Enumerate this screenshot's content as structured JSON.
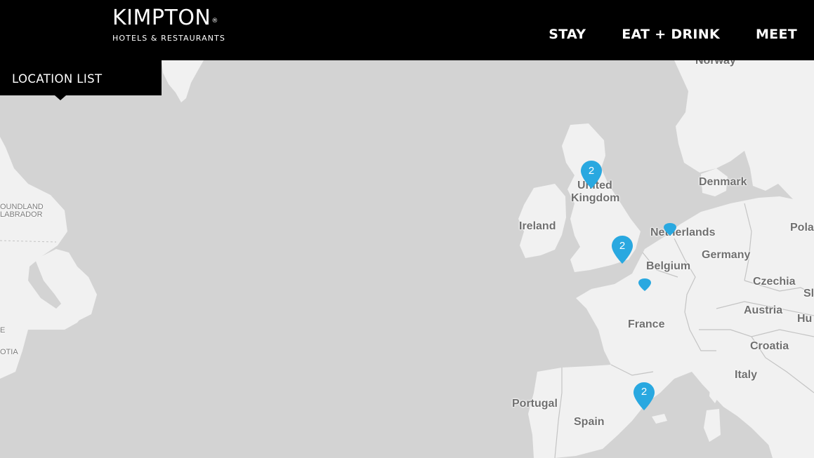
{
  "header": {
    "logo": {
      "main": "KIMPTON",
      "registered": "®",
      "sub": "HOTELS & RESTAURANTS"
    },
    "nav": [
      {
        "label": "STAY"
      },
      {
        "label": "EAT + DRINK"
      },
      {
        "label": "MEET"
      }
    ]
  },
  "location_list": {
    "label": "LOCATION LIST"
  },
  "map": {
    "colors": {
      "water": "#d3d3d3",
      "land": "#f1f1f1",
      "border": "#c4c4c4",
      "marker": "#29a8e0"
    },
    "labels": {
      "norway": "Norway",
      "united_kingdom_1": "United",
      "united_kingdom_2": "Kingdom",
      "ireland": "Ireland",
      "denmark": "Denmark",
      "netherlands": "Netherlands",
      "germany": "Germany",
      "belgium": "Belgium",
      "poland": "Pola",
      "czechia": "Czechia",
      "slovakia": "Sl",
      "austria": "Austria",
      "hungary": "Hu",
      "france": "France",
      "croatia": "Croatia",
      "italy": "Italy",
      "portugal": "Portugal",
      "spain": "Spain",
      "newfoundland_1": "OUNDLAND",
      "newfoundland_2": "LABRADOR",
      "nova_scotia_1": "E",
      "nova_scotia_2": "OTIA"
    },
    "markers": [
      {
        "name": "marker-scotland",
        "count": "2"
      },
      {
        "name": "marker-london",
        "count": "2"
      },
      {
        "name": "marker-amsterdam",
        "count": ""
      },
      {
        "name": "marker-paris",
        "count": ""
      },
      {
        "name": "marker-barcelona",
        "count": "2"
      }
    ]
  }
}
